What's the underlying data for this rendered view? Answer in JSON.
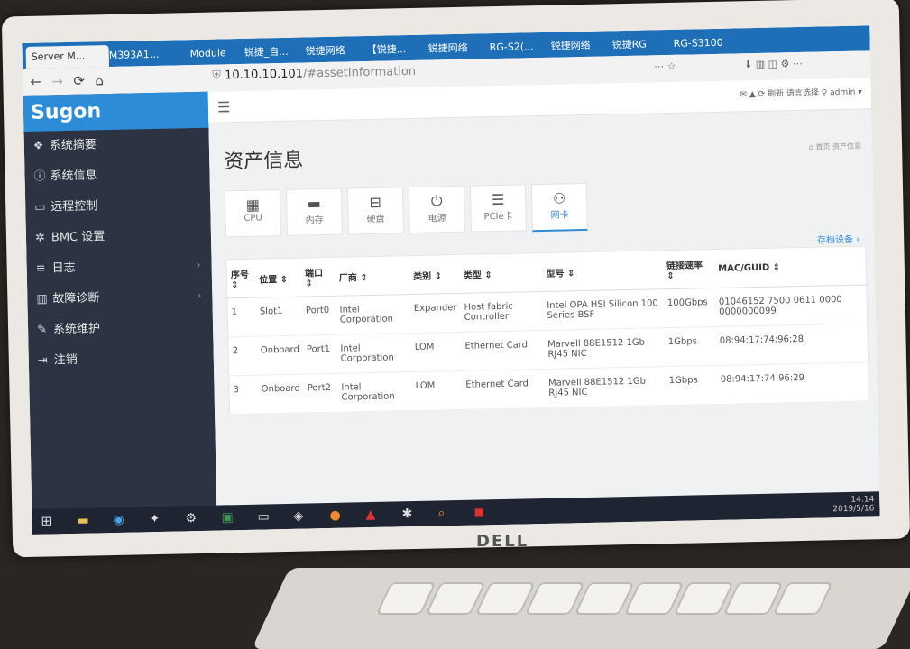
{
  "browser": {
    "tabs": [
      "Server M...",
      "M393A1...",
      "Module",
      "锐捷_自...",
      "锐捷网络",
      "【锐捷...",
      "锐捷网络",
      "RG-S2(...",
      "锐捷网络",
      "锐捷RG",
      "RG-S3100"
    ],
    "url_host": "10.10.10.101",
    "url_path": "/#assetInformation"
  },
  "app": {
    "brand": "Sugon",
    "sidebar": [
      {
        "label": "系统摘要",
        "icon": "dashboard-icon"
      },
      {
        "label": "系统信息",
        "icon": "info-icon"
      },
      {
        "label": "远程控制",
        "icon": "monitor-icon"
      },
      {
        "label": "BMC 设置",
        "icon": "gear-icon"
      },
      {
        "label": "日志",
        "icon": "log-icon"
      },
      {
        "label": "故障诊断",
        "icon": "chart-icon"
      },
      {
        "label": "系统维护",
        "icon": "wrench-icon"
      },
      {
        "label": "注销",
        "icon": "logout-icon"
      }
    ],
    "topbar_right": "✉  ▲  ⟳ 刷新   语言选择   ⚲ admin ▾",
    "page_title": "资产信息",
    "breadcrumb": "⌂ 首页  资产信息",
    "saved_link": "存档设备 ›",
    "tiles": [
      {
        "label": "CPU",
        "glyph": "▦"
      },
      {
        "label": "内存",
        "glyph": "▬"
      },
      {
        "label": "硬盘",
        "glyph": "⊟"
      },
      {
        "label": "电源",
        "glyph": "⏻"
      },
      {
        "label": "PCIe卡",
        "glyph": "☰"
      },
      {
        "label": "网卡",
        "glyph": "⚇"
      }
    ],
    "table": {
      "headers": [
        "序号 ⇕",
        "位置 ⇕",
        "端口 ⇕",
        "厂商 ⇕",
        "类别 ⇕",
        "类型 ⇕",
        "型号 ⇕",
        "链接速率 ⇕",
        "MAC/GUID ⇕"
      ],
      "rows": [
        [
          "1",
          "Slot1",
          "Port0",
          "Intel Corporation",
          "Expander",
          "Host fabric Controller",
          "Intel OPA HSI Silicon 100 Series-BSF",
          "100Gbps",
          "01046152 7500 0611 0000 0000000099"
        ],
        [
          "2",
          "Onboard",
          "Port1",
          "Intel Corporation",
          "LOM",
          "Ethernet Card",
          "Marvell 88E1512 1Gb RJ45 NIC",
          "1Gbps",
          "08:94:17:74:96:28"
        ],
        [
          "3",
          "Onboard",
          "Port2",
          "Intel Corporation",
          "LOM",
          "Ethernet Card",
          "Marvell 88E1512 1Gb RJ45 NIC",
          "1Gbps",
          "08:94:17:74:96:29"
        ]
      ]
    }
  },
  "taskbar": {
    "time": "14:14",
    "date": "2019/5/16"
  },
  "hardware": {
    "logo": "DELL"
  }
}
